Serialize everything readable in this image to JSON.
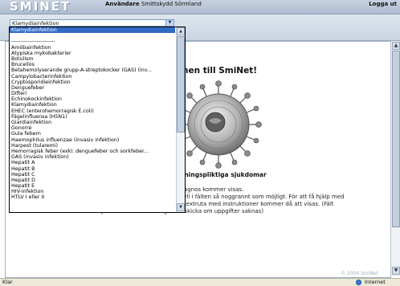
{
  "header": {
    "logo": "SMINET",
    "user_label": "Användare",
    "user_value": "Smittskydd Sörmland",
    "logout": "Logga ut"
  },
  "select": {
    "value": "Klamydiainfektion",
    "options": [
      "Klamydiainfektion",
      "",
      "------------------------",
      "Amöbainfektion",
      "Atypiska mykobakterier",
      "Botulism",
      "Brucellos",
      "Betahemolyserande grupp-A-streptokocker (GAS) (inv...",
      "Campylobacterinfektion",
      "Cryptosporidieinfektion",
      "Denguefeber",
      "Difteri",
      "Echinokockinfektion",
      "Klamydiainfektion",
      "EHEC (enterohemorragisk E.coli)",
      "Fågelinfluensa (H5N1)",
      "Giardiainfektion",
      "Gonorré",
      "Gula febern",
      "Haemophilus influenzae (invasiv infektion)",
      "Harpest (tularemi)",
      "Hemorragisk feber (exkl. denguefeber och sorkfeber...",
      "GAS (invasiv infektion)",
      "Hepatit A",
      "Hepatit B",
      "Hepatit C",
      "Hepatit D",
      "Hepatit E",
      "HIV-infektion",
      "HTLV I eller II"
    ],
    "selected_index": 0
  },
  "main": {
    "welcome": "nen till SmiNet!",
    "heading": "mälningspliktiga sjukdomar",
    "p1": "a diagnos kommer visas.",
    "p2": "n. Fyll i fälten så noggrannt som möjligt. För att få hjälp med",
    "p3": "gul textruta med instruktioner kommer då att visas. (Fält",
    "p4": "markerade med * betyder att anmälan inte går att skicka om uppgifter saknas)",
    "p5": "",
    "copyright": "© 2004 SmiNet"
  },
  "statusbar": {
    "text": "Klar",
    "zone": "Internet"
  }
}
